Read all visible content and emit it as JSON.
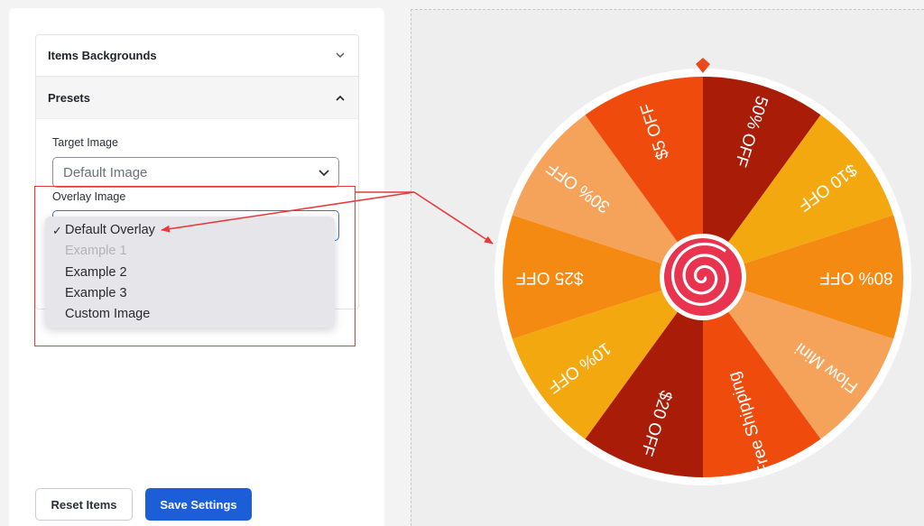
{
  "sidebar": {
    "sections": [
      {
        "label": "Items Backgrounds",
        "icon": "chevron-down-icon"
      },
      {
        "label": "Presets",
        "icon": "chevron-up-icon"
      }
    ],
    "target_image": {
      "label": "Target Image",
      "value": "Default Image"
    },
    "overlay_image": {
      "label": "Overlay Image",
      "options": [
        {
          "label": "Default Overlay",
          "selected": true
        },
        {
          "label": "Example 1",
          "disabled": true
        },
        {
          "label": "Example 2"
        },
        {
          "label": "Example 3"
        },
        {
          "label": "Custom Image"
        }
      ]
    },
    "reset_label": "Reset Items",
    "save_label": "Save Settings"
  },
  "wheel": {
    "pointer_color": "#e84a1c",
    "center_icon": "spiral-lollipop-icon",
    "segments": [
      {
        "label": "50% OFF",
        "color": "#a81c08"
      },
      {
        "label": "$10 OFF",
        "color": "#f2a80e"
      },
      {
        "label": "80% OFF",
        "color": "#f58a12"
      },
      {
        "label": "Flow Mini",
        "color": "#f5a35a"
      },
      {
        "label": "Free Shipping",
        "color": "#ee4b0c"
      },
      {
        "label": "$20 OFF",
        "color": "#a81c08"
      },
      {
        "label": "10% OFF",
        "color": "#f2a80e"
      },
      {
        "label": "$25 OFF",
        "color": "#f58a12"
      },
      {
        "label": "30% OFF",
        "color": "#f5a35a"
      },
      {
        "label": "$5 OFF",
        "color": "#ee4b0c"
      }
    ]
  },
  "annotation": {
    "color": "#e53b3b"
  }
}
